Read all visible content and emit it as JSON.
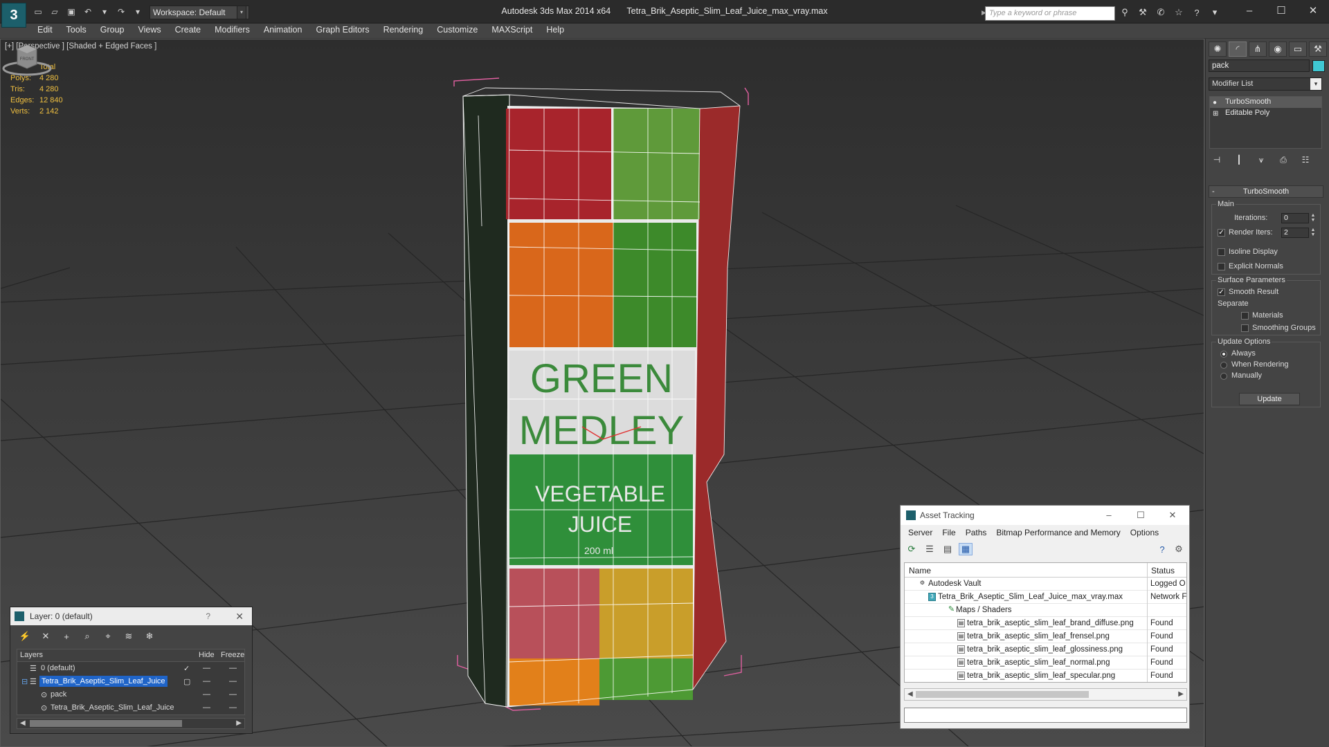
{
  "window": {
    "app_name": "Autodesk 3ds Max  2014 x64",
    "file_name": "Tetra_Brik_Aseptic_Slim_Leaf_Juice_max_vray.max",
    "logo_glyph": "3",
    "workspace": "Workspace: Default",
    "search_placeholder": "Type a keyword or phrase"
  },
  "menu": [
    "Edit",
    "Tools",
    "Group",
    "Views",
    "Create",
    "Modifiers",
    "Animation",
    "Graph Editors",
    "Rendering",
    "Customize",
    "MAXScript",
    "Help"
  ],
  "viewport": {
    "label": "[+] [Perspective ] [Shaded + Edged Faces ]",
    "stats": {
      "header": "Total",
      "rows": [
        {
          "key": "Polys:",
          "value": "4 280"
        },
        {
          "key": "Tris:",
          "value": "4 280"
        },
        {
          "key": "Edges:",
          "value": "12 840"
        },
        {
          "key": "Verts:",
          "value": "2 142"
        }
      ]
    },
    "viewcube_label": "FRONT",
    "stats_color": "#f0c040",
    "package": {
      "title_line1": "GREEN",
      "title_line2": "MEDLEY",
      "subtitle_line1": "VEGETABLE",
      "subtitle_line2": "JUICE",
      "volume": "200 ml",
      "label_green": "#2f8f3a"
    }
  },
  "command_panel": {
    "object_name": "pack",
    "object_color": "#3fc8d3",
    "modifier_list": "Modifier List",
    "stack": [
      "TurboSmooth",
      "Editable Poly"
    ],
    "rollout_title": "TurboSmooth",
    "main_group": "Main",
    "iterations_label": "Iterations:",
    "iterations_value": "0",
    "render_iters_label": "Render Iters:",
    "render_iters_value": "2",
    "render_iters_checked": true,
    "isoline_label": "Isoline Display",
    "explicit_normals_label": "Explicit Normals",
    "surface_group": "Surface Parameters",
    "smooth_result_label": "Smooth Result",
    "smooth_result_checked": true,
    "separate_label": "Separate",
    "materials_label": "Materials",
    "smoothing_groups_label": "Smoothing Groups",
    "update_group": "Update Options",
    "update_always": "Always",
    "update_rendering": "When Rendering",
    "update_manually": "Manually",
    "update_button": "Update"
  },
  "layer_dialog": {
    "title": "Layer: 0 (default)",
    "help": "?",
    "columns": {
      "layers": "Layers",
      "hide": "Hide",
      "freeze": "Freeze"
    },
    "rows": [
      {
        "name": "0 (default)",
        "indent": 1,
        "active": true
      },
      {
        "name": "Tetra_Brik_Aseptic_Slim_Leaf_Juice",
        "indent": 1,
        "selected": true
      },
      {
        "name": "pack",
        "indent": 2
      },
      {
        "name": "Tetra_Brik_Aseptic_Slim_Leaf_Juice",
        "indent": 2
      }
    ]
  },
  "asset_tracking": {
    "title": "Asset Tracking",
    "menu": [
      "Server",
      "File",
      "Paths",
      "Bitmap Performance and Memory",
      "Options"
    ],
    "columns": {
      "name": "Name",
      "status": "Status"
    },
    "rows": [
      {
        "name": "Autodesk Vault",
        "status": "Logged O",
        "indent": 1
      },
      {
        "name": "Tetra_Brik_Aseptic_Slim_Leaf_Juice_max_vray.max",
        "status": "Network F",
        "indent": 2
      },
      {
        "name": "Maps / Shaders",
        "status": "",
        "indent": 3
      },
      {
        "name": "tetra_brik_aseptic_slim_leaf_brand_diffuse.png",
        "status": "Found",
        "indent": 4
      },
      {
        "name": "tetra_brik_aseptic_slim_leaf_frensel.png",
        "status": "Found",
        "indent": 4
      },
      {
        "name": "tetra_brik_aseptic_slim_leaf_glossiness.png",
        "status": "Found",
        "indent": 4
      },
      {
        "name": "tetra_brik_aseptic_slim_leaf_normal.png",
        "status": "Found",
        "indent": 4
      },
      {
        "name": "tetra_brik_aseptic_slim_leaf_specular.png",
        "status": "Found",
        "indent": 4
      }
    ]
  }
}
